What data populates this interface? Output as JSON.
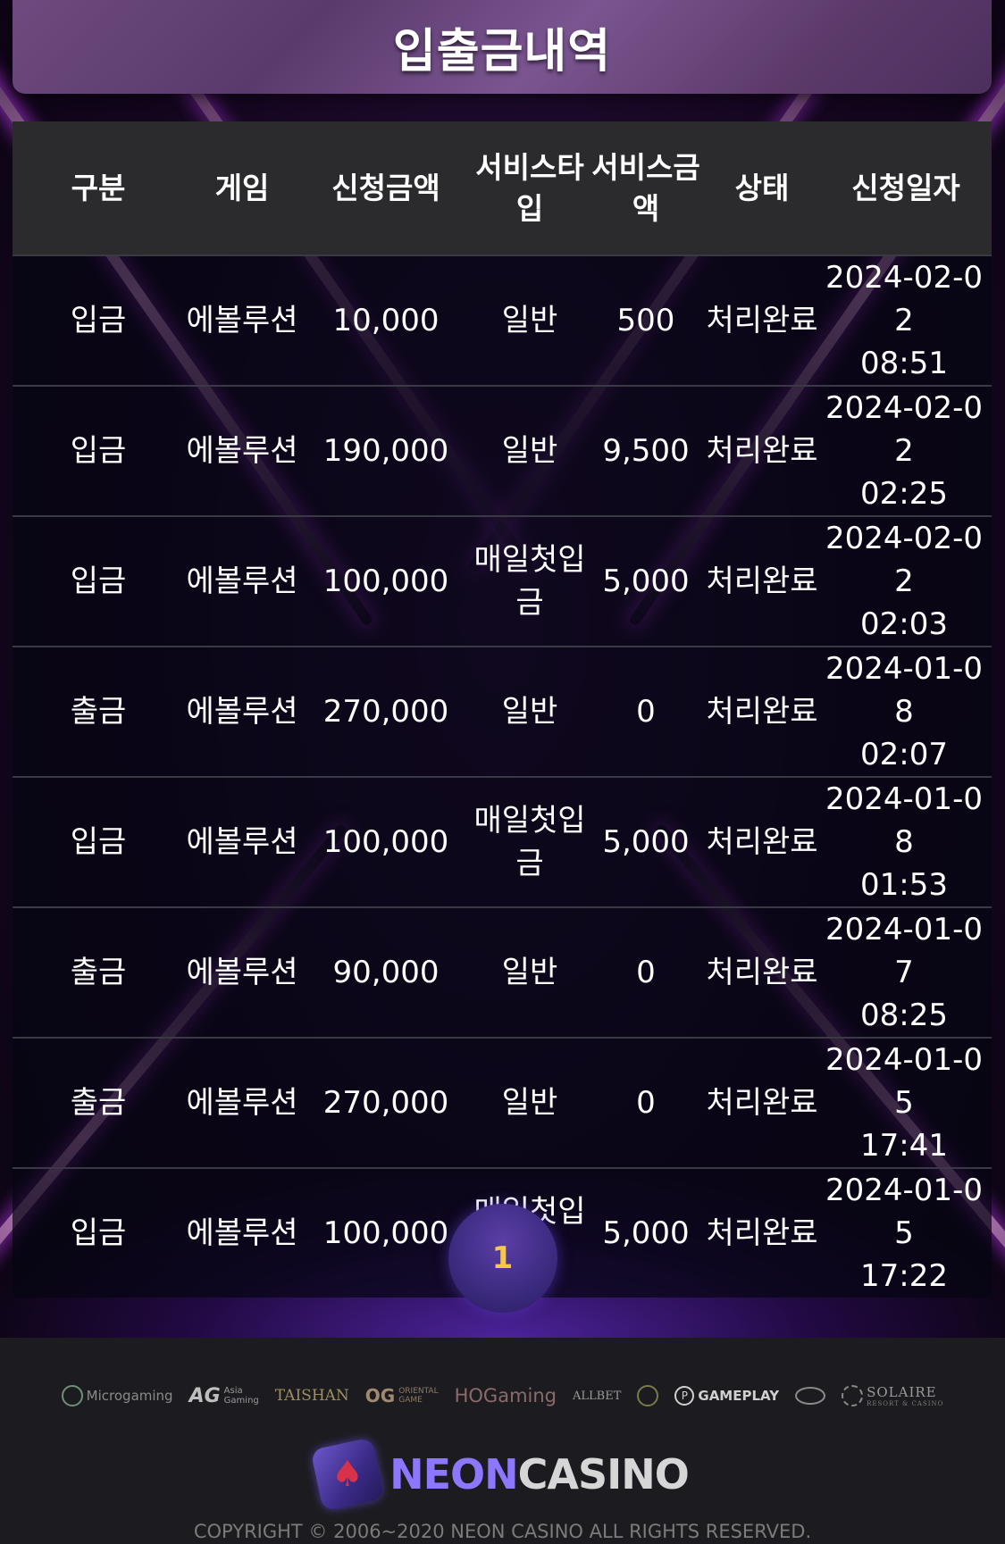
{
  "page": {
    "title": "입출금내역"
  },
  "table": {
    "headers": [
      "구분",
      "게임",
      "신청금액",
      "서비스타입",
      "서비스금액",
      "상태",
      "신청일자"
    ],
    "rows": [
      {
        "type": "입금",
        "game": "에볼루션",
        "amount": "10,000",
        "service_type": "일반",
        "service_amount": "500",
        "status": "처리완료",
        "date": "2024-02-02",
        "time": "08:51"
      },
      {
        "type": "입금",
        "game": "에볼루션",
        "amount": "190,000",
        "service_type": "일반",
        "service_amount": "9,500",
        "status": "처리완료",
        "date": "2024-02-02",
        "time": "02:25"
      },
      {
        "type": "입금",
        "game": "에볼루션",
        "amount": "100,000",
        "service_type": "매일첫입금",
        "service_amount": "5,000",
        "status": "처리완료",
        "date": "2024-02-02",
        "time": "02:03"
      },
      {
        "type": "출금",
        "game": "에볼루션",
        "amount": "270,000",
        "service_type": "일반",
        "service_amount": "0",
        "status": "처리완료",
        "date": "2024-01-08",
        "time": "02:07"
      },
      {
        "type": "입금",
        "game": "에볼루션",
        "amount": "100,000",
        "service_type": "매일첫입금",
        "service_amount": "5,000",
        "status": "처리완료",
        "date": "2024-01-08",
        "time": "01:53"
      },
      {
        "type": "출금",
        "game": "에볼루션",
        "amount": "90,000",
        "service_type": "일반",
        "service_amount": "0",
        "status": "처리완료",
        "date": "2024-01-07",
        "time": "08:25"
      },
      {
        "type": "출금",
        "game": "에볼루션",
        "amount": "270,000",
        "service_type": "일반",
        "service_amount": "0",
        "status": "처리완료",
        "date": "2024-01-05",
        "time": "17:41"
      },
      {
        "type": "입금",
        "game": "에볼루션",
        "amount": "100,000",
        "service_type": "매일첫입금",
        "service_amount": "5,000",
        "status": "처리완료",
        "date": "2024-01-05",
        "time": "17:22"
      }
    ]
  },
  "pagination": {
    "current_page": "1"
  },
  "footer": {
    "partners": {
      "microgaming": "Microgaming",
      "ag_mark": "AG",
      "ag_sub_1": "Asia",
      "ag_sub_2": "Gaming",
      "taishan": "TAISHAN",
      "og_mark": "OG",
      "og_sub_1": "ORIENTAL",
      "og_sub_2": "GAME",
      "hogaming": "HOGaming",
      "allbet": "ALLBET",
      "gameplay": "GAMEPLAY",
      "solaire": "SOLAIRE",
      "solaire_sub": "RESORT & CASINO"
    },
    "brand_neon": "NEON",
    "brand_casino": "CASINO",
    "copyright": "COPYRIGHT © 2006~2020 NEON CASINO ALL RIGHTS RESERVED."
  },
  "icons": {
    "brand_logo": "spade-icon",
    "microgaming_logo": "microgaming-icon",
    "gameplay_logo": "gameplay-icon"
  },
  "colors": {
    "page_number": "#f7c845",
    "brand_neon": "#8d77ff",
    "brand_casino": "#d6d6d6",
    "header_row_bg": "#2b2b2e",
    "footer_bg": "#1c1c20"
  }
}
